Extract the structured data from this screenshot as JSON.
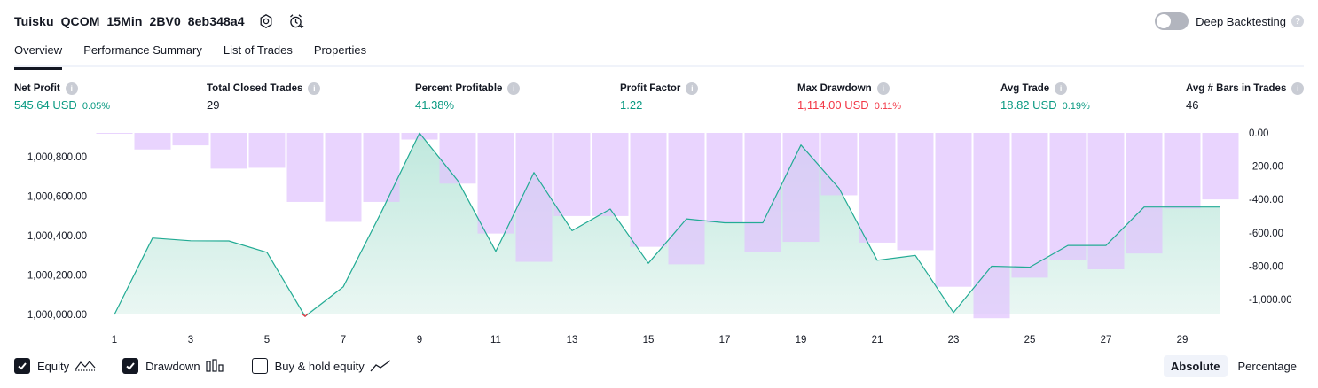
{
  "header": {
    "title": "Tuisku_QCOM_15Min_2BV0_8eb348a4",
    "settings_icon": "gear-icon",
    "alert_icon": "alarm-clock-plus-icon"
  },
  "deep_backtesting": {
    "label": "Deep Backtesting",
    "enabled": false,
    "help": "?"
  },
  "tabs": [
    {
      "label": "Overview",
      "active": true
    },
    {
      "label": "Performance Summary",
      "active": false
    },
    {
      "label": "List of Trades",
      "active": false
    },
    {
      "label": "Properties",
      "active": false
    }
  ],
  "metrics": [
    {
      "label": "Net Profit",
      "value": "545.64 USD",
      "pct": "0.05%",
      "color": "green"
    },
    {
      "label": "Total Closed Trades",
      "value": "29",
      "pct": "",
      "color": "dark"
    },
    {
      "label": "Percent Profitable",
      "value": "41.38%",
      "pct": "",
      "color": "green"
    },
    {
      "label": "Profit Factor",
      "value": "1.22",
      "pct": "",
      "color": "green"
    },
    {
      "label": "Max Drawdown",
      "value": "1,114.00 USD",
      "pct": "0.11%",
      "color": "red"
    },
    {
      "label": "Avg Trade",
      "value": "18.82 USD",
      "pct": "0.19%",
      "color": "green"
    },
    {
      "label": "Avg # Bars in Trades",
      "value": "46",
      "pct": "",
      "color": "dark"
    }
  ],
  "chart_data": {
    "type": "area",
    "x_ticks": [
      "1",
      "3",
      "5",
      "7",
      "9",
      "11",
      "13",
      "15",
      "17",
      "19",
      "21",
      "23",
      "25",
      "27",
      "29"
    ],
    "left_axis_ticks": [
      "1,000,000.00",
      "1,000,200.00",
      "1,000,400.00",
      "1,000,600.00",
      "1,000,800.00"
    ],
    "right_axis_ticks": [
      "0.00",
      "-200.00",
      "-400.00",
      "-600.00",
      "-800.00",
      "-1,000.00"
    ],
    "left_ylim": [
      1000000,
      1000920
    ],
    "right_ylim": [
      -1114,
      0
    ],
    "series": [
      {
        "name": "Equity",
        "axis": "left",
        "x": [
          1,
          2,
          3,
          4,
          5,
          6,
          7,
          8,
          9,
          10,
          11,
          12,
          13,
          14,
          15,
          16,
          17,
          18,
          19,
          20,
          21,
          22,
          23,
          24,
          25,
          26,
          27,
          28,
          29,
          30
        ],
        "values": [
          1000000,
          1000388,
          1000374,
          1000373,
          1000315,
          999990,
          1000140,
          1000520,
          1000920,
          1000680,
          1000320,
          1000720,
          1000425,
          1000535,
          1000260,
          1000485,
          1000465,
          1000465,
          1000860,
          1000640,
          1000275,
          1000300,
          1000010,
          1000245,
          1000240,
          1000350,
          1000350,
          1000545,
          1000545,
          1000545
        ]
      },
      {
        "name": "Drawdown",
        "axis": "right",
        "values": [
          -3,
          -100,
          -75,
          -215,
          -210,
          -415,
          -535,
          -415,
          -40,
          -305,
          -605,
          -775,
          -500,
          -500,
          -685,
          -790,
          -540,
          -715,
          -655,
          -375,
          -660,
          -705,
          -925,
          -1114,
          -870,
          -765,
          -820,
          -725,
          -455,
          -400
        ]
      }
    ],
    "colors": {
      "equity_line": "#22ab94",
      "equity_fill": "#d8f1ea",
      "drawdown_fill": "#e1c4fd",
      "negative_equity": "#f23645"
    }
  },
  "legend": {
    "items": [
      {
        "label": "Equity",
        "checked": true,
        "icon": "equity-line-icon"
      },
      {
        "label": "Drawdown",
        "checked": true,
        "icon": "drawdown-bars-icon"
      },
      {
        "label": "Buy & hold equity",
        "checked": false,
        "icon": "buy-hold-line-icon"
      }
    ],
    "modes": [
      {
        "label": "Absolute",
        "active": true
      },
      {
        "label": "Percentage",
        "active": false
      }
    ]
  }
}
